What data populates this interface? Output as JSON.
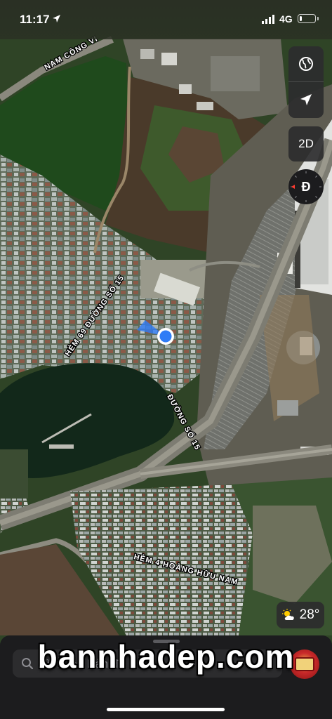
{
  "status_bar": {
    "time": "11:17",
    "network": "4G",
    "battery_level": 0.15,
    "icons": [
      "location-arrow-icon",
      "signal-icon",
      "battery-icon"
    ]
  },
  "map": {
    "view": "satellite",
    "street_labels": [
      "NAM CÔNG VI",
      "HẺM 69 ĐƯỜNG SỐ 15",
      "ĐƯỜNG SỐ 15",
      "HẺM 4 HOÀNG HỮU NAM"
    ]
  },
  "controls": {
    "map_type_icon": "globe-icon",
    "locate_icon": "location-arrow-icon",
    "view_mode_label": "2D",
    "compass_label": "Đ"
  },
  "weather": {
    "icon": "partly-cloudy-icon",
    "temperature": "28°"
  },
  "search": {
    "placeholder": "Tìm trên Bản đồ",
    "icon": "search-icon"
  },
  "account": {
    "icon": "avatar-icon"
  },
  "watermark": {
    "text": "bannhadep.com"
  },
  "colors": {
    "user_location": "#2f7cf6",
    "panel_bg": "#2c2c2e",
    "sheet_bg": "#1c1c1e",
    "compass_red": "#ff3b30"
  }
}
